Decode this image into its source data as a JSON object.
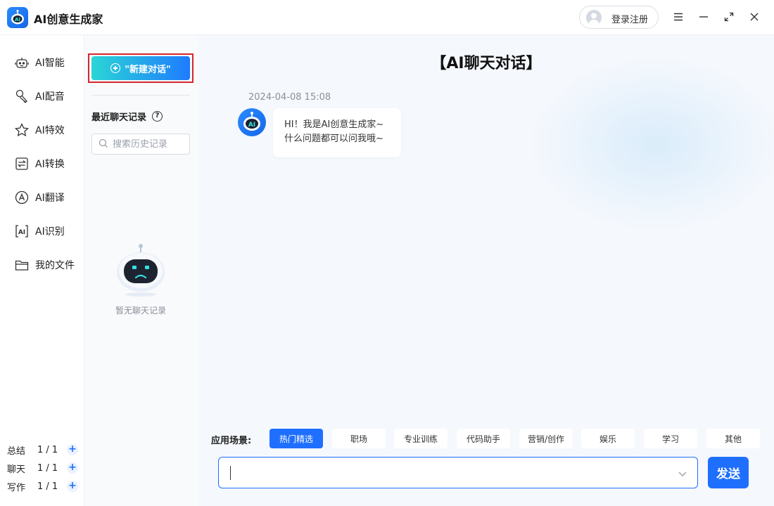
{
  "app": {
    "title": "AI创意生成家",
    "logo_icon": "robot-logo-icon"
  },
  "titlebar": {
    "login_label": "登录注册",
    "controls": [
      "menu-icon",
      "minimize-icon",
      "maximize-icon",
      "close-icon"
    ]
  },
  "sidebar": {
    "items": [
      {
        "label": "AI智能",
        "icon": "robot-icon"
      },
      {
        "label": "AI配音",
        "icon": "microphone-icon"
      },
      {
        "label": "AI特效",
        "icon": "star-icon"
      },
      {
        "label": "AI转换",
        "icon": "convert-icon"
      },
      {
        "label": "AI翻译",
        "icon": "translate-icon"
      },
      {
        "label": "AI识别",
        "icon": "scan-icon"
      },
      {
        "label": "我的文件",
        "icon": "folder-icon"
      }
    ],
    "usage": [
      {
        "label": "总结",
        "count": "1 / 1"
      },
      {
        "label": "聊天",
        "count": "1 / 1"
      },
      {
        "label": "写作",
        "count": "1 / 1"
      }
    ]
  },
  "history": {
    "new_chat_label": "\"新建对话\"",
    "recent_title": "最近聊天记录",
    "search_placeholder": "搜索历史记录",
    "empty_text": "暂无聊天记录"
  },
  "chat": {
    "title": "【AI聊天对话】",
    "message": {
      "time": "2024-04-08 15:08",
      "line1": "HI！我是AI创意生成家~",
      "line2": "什么问题都可以问我哦~"
    },
    "scene_label": "应用场景:",
    "scenes": [
      "热门精选",
      "职场",
      "专业训练",
      "代码助手",
      "营销/创作",
      "娱乐",
      "学习",
      "其他"
    ],
    "active_scene": "热门精选",
    "input_value": "",
    "send_label": "发送"
  },
  "colors": {
    "accent": "#1f6fff",
    "highlight_border": "#d4262c",
    "gradient_start": "#2ad6d6"
  }
}
